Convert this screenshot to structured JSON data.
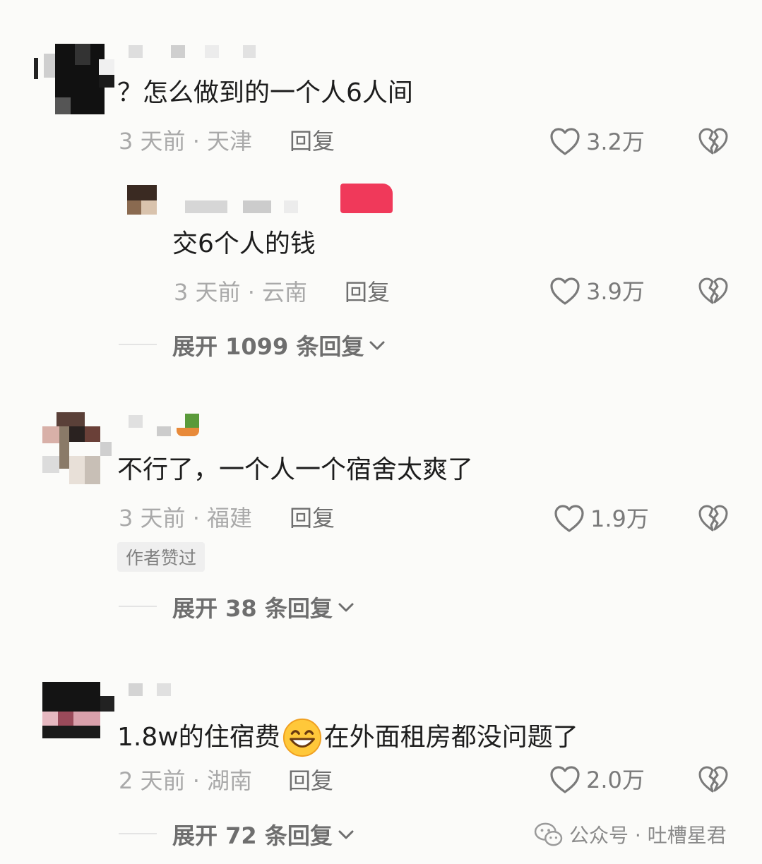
{
  "comments": [
    {
      "text": "？怎么做到的一个人6人间",
      "meta": "3 天前 · 天津",
      "reply_label": "回复",
      "likes": "3.2万",
      "replies": [
        {
          "text": "交6个人的钱",
          "meta": "3 天前 · 云南",
          "reply_label": "回复",
          "likes": "3.9万"
        }
      ],
      "expand_label": "展开 1099 条回复"
    },
    {
      "text": "不行了，一个人一个宿舍太爽了",
      "meta": "3 天前 · 福建",
      "reply_label": "回复",
      "likes": "1.9万",
      "badge": "作者赞过",
      "expand_label": "展开 38 条回复"
    },
    {
      "text_before_emoji": "1.8w的住宿费",
      "emoji": "grinning-face-emoji",
      "text_after_emoji": "在外面租房都没问题了",
      "meta": "2 天前 · 湖南",
      "reply_label": "回复",
      "likes": "2.0万",
      "expand_label": "展开 72 条回复"
    }
  ],
  "watermark": {
    "icon": "wechat-icon",
    "text": "公众号 · 吐槽星君"
  },
  "colors": {
    "background": "#fbfbf9",
    "author_tag": "#f0395a",
    "meta_text": "#a9a9a9"
  }
}
